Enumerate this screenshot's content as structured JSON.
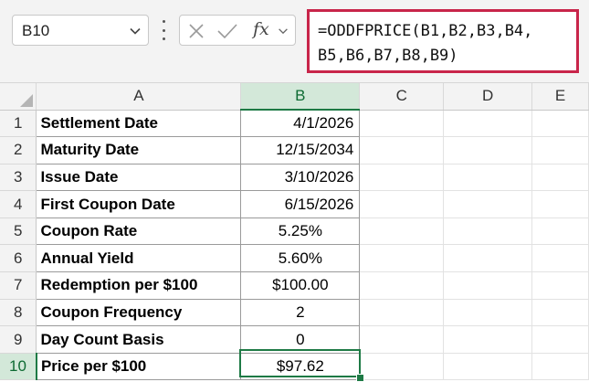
{
  "name_box": {
    "value": "B10"
  },
  "formula_bar": {
    "fx_label": "fx",
    "formula": "=ODDFPRICE(B1,B2,B3,B4,\nB5,B6,B7,B8,B9)"
  },
  "columns": [
    "A",
    "B",
    "C",
    "D",
    "E"
  ],
  "rows": [
    {
      "num": "1",
      "label": "Settlement Date",
      "value": "4/1/2026",
      "align": "right"
    },
    {
      "num": "2",
      "label": "Maturity Date",
      "value": "12/15/2034",
      "align": "right"
    },
    {
      "num": "3",
      "label": "Issue Date",
      "value": "3/10/2026",
      "align": "right"
    },
    {
      "num": "4",
      "label": "First Coupon Date",
      "value": "6/15/2026",
      "align": "right"
    },
    {
      "num": "5",
      "label": "Coupon Rate",
      "value": "5.25%",
      "align": "center"
    },
    {
      "num": "6",
      "label": "Annual Yield",
      "value": "5.60%",
      "align": "center"
    },
    {
      "num": "7",
      "label": "Redemption per $100",
      "value": "$100.00",
      "align": "center"
    },
    {
      "num": "8",
      "label": "Coupon Frequency",
      "value": "2",
      "align": "center"
    },
    {
      "num": "9",
      "label": "Day Count Basis",
      "value": "0",
      "align": "center"
    },
    {
      "num": "10",
      "label": "Price per $100",
      "value": "$97.62",
      "align": "center"
    }
  ],
  "selected": {
    "column": "B",
    "row": "10"
  },
  "colors": {
    "accent_green": "#1e7a45",
    "formula_highlight": "#c8254a"
  }
}
